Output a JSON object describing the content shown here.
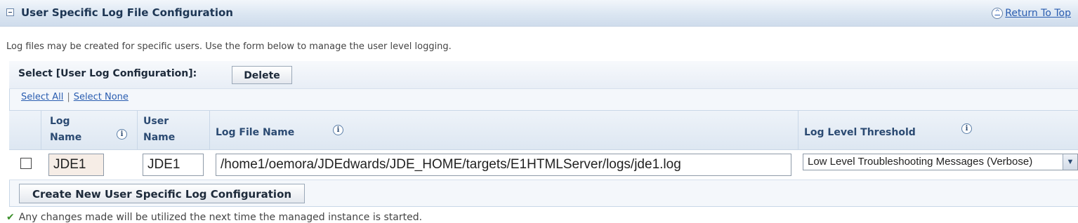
{
  "section": {
    "title": "User Specific Log File Configuration",
    "return_top": "Return To Top"
  },
  "intro": "Log files may be created for specific users. Use the form below to manage the user level logging.",
  "selection": {
    "label": "Select [User Log Configuration]:",
    "delete_label": "Delete",
    "select_all": "Select All",
    "separator": "|",
    "select_none": "Select None"
  },
  "table": {
    "headers": {
      "log_name_1": "Log",
      "log_name_2": "Name",
      "user_name_1": "User",
      "user_name_2": "Name",
      "log_file_name": "Log File Name",
      "log_level": "Log Level Threshold"
    },
    "rows": [
      {
        "checked": false,
        "log_name": "JDE1",
        "user_name": "JDE1",
        "log_file_name": "/home1/oemora/JDEdwards/JDE_HOME/targets/E1HTMLServer/logs/jde1.log",
        "log_level": "Low Level Troubleshooting Messages (Verbose)"
      }
    ]
  },
  "create_label": "Create New User Specific Log Configuration",
  "footer_message": "Any changes made will be utilized the next time the managed instance is started.",
  "icons": {
    "collapse": "collapse-icon",
    "return_top": "chevron-up-icon",
    "info": "info-icon",
    "dropdown": "chevron-down-icon",
    "success": "check-icon"
  },
  "colors": {
    "header_text": "#1d3654",
    "link": "#2a5db0",
    "column_header": "#2b4a72",
    "success": "#3a8f2a"
  }
}
